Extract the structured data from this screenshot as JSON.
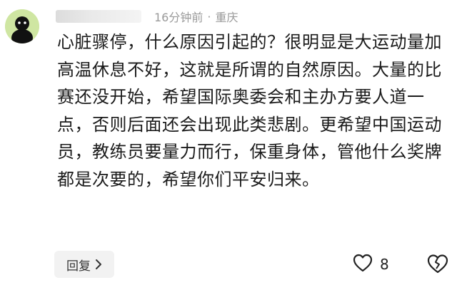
{
  "comment": {
    "username": "用户",
    "time": "16分钟前",
    "separator": "·",
    "location": "重庆",
    "text": "心脏骤停，什么原因引起的？很明显是大运动量加高温休息不好，这就是所谓的自然原因。大量的比赛还没开始，希望国际奥委会和主办方要人道一点，否则后面还会出现此类悲剧。更希望中国运动员，教练员要量力而行，保重身体，管他什么奖牌都是次要的，希望你们平安归来。",
    "reply_label": "回复",
    "like_count": "8"
  },
  "icons": {
    "avatar": "black-figure-avatar",
    "reply_chevron": "chevron-right-icon",
    "like": "heart-icon",
    "share": "broken-heart-icon"
  },
  "colors": {
    "avatar_bg": "#cfe6a2",
    "meta_text": "#9a9a9a",
    "body_text": "#1b1b1b",
    "reply_bg": "#f2f2f2"
  }
}
